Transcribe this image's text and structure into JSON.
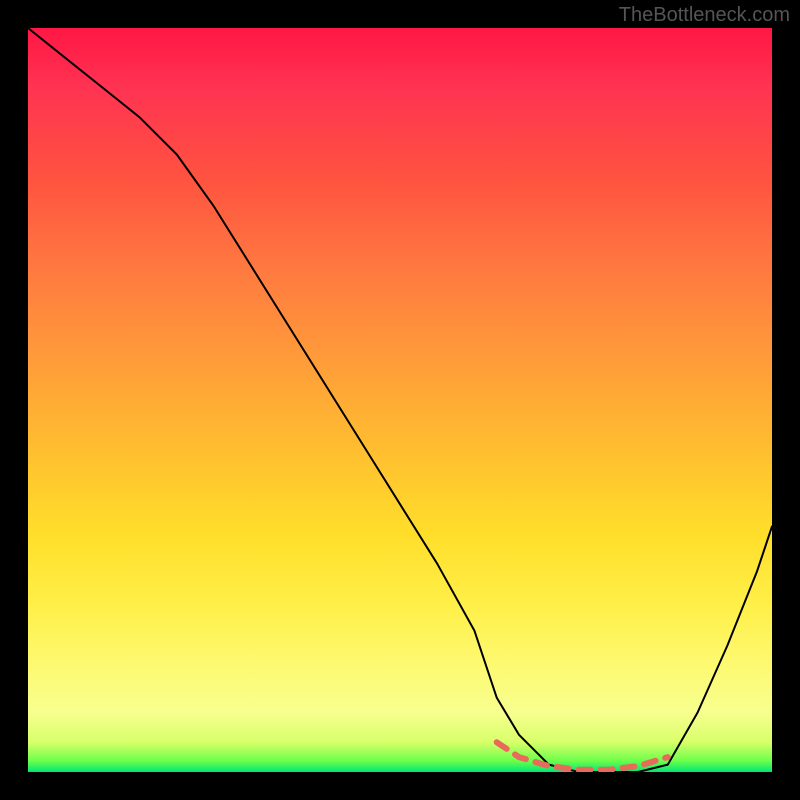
{
  "watermark": "TheBottleneck.com",
  "chart_data": {
    "type": "line",
    "title": "",
    "xlabel": "",
    "ylabel": "",
    "x_range": [
      0,
      100
    ],
    "y_range": [
      0,
      100
    ],
    "series": [
      {
        "name": "bottleneck-curve",
        "x": [
          0,
          5,
          10,
          15,
          20,
          25,
          30,
          35,
          40,
          45,
          50,
          55,
          60,
          63,
          66,
          70,
          74,
          78,
          82,
          86,
          90,
          94,
          98,
          100
        ],
        "y": [
          100,
          96,
          92,
          88,
          83,
          76,
          68,
          60,
          52,
          44,
          36,
          28,
          19,
          10,
          5,
          1,
          0,
          0,
          0,
          1,
          8,
          17,
          27,
          33
        ]
      }
    ],
    "optimal_zone": {
      "name": "optimal-range-marker",
      "x": [
        63,
        66,
        70,
        74,
        78,
        82,
        86
      ],
      "y": [
        4,
        2,
        0.8,
        0.3,
        0.3,
        0.8,
        2
      ]
    },
    "background_gradient": {
      "top_color": "#ff1744",
      "mid_color": "#ffde2a",
      "bottom_color": "#00e676",
      "meaning": "red=high bottleneck, green=low bottleneck"
    }
  }
}
